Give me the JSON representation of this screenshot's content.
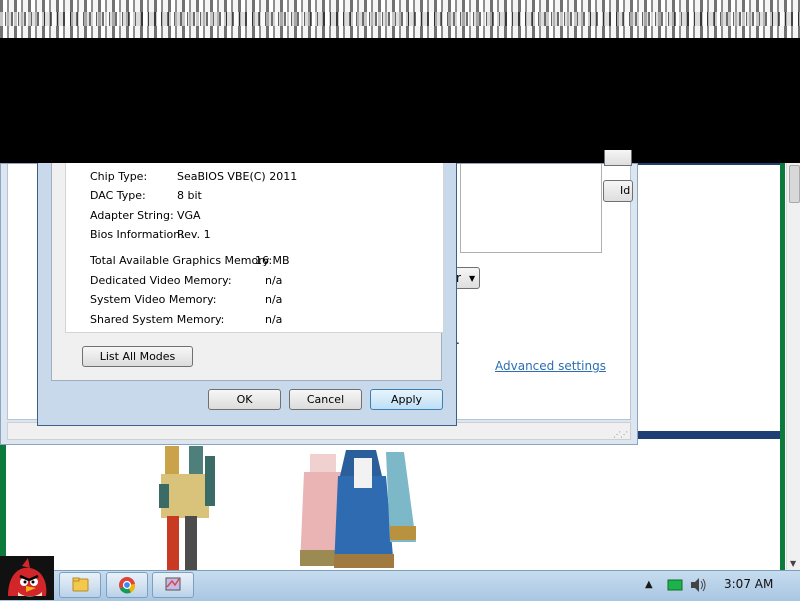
{
  "dialog": {
    "rows": [
      {
        "label": "Chip Type:",
        "value": "SeaBIOS VBE(C) 2011"
      },
      {
        "label": "DAC Type:",
        "value": "8 bit"
      },
      {
        "label": "Adapter String:",
        "value": "VGA"
      },
      {
        "label": "Bios Information:",
        "value": "Rev. 1"
      }
    ],
    "memory": [
      {
        "label": "Total Available Graphics Memory:",
        "value": "16 MB"
      },
      {
        "label": "Dedicated Video Memory:",
        "value": "n/a"
      },
      {
        "label": "System Video Memory:",
        "value": "n/a"
      },
      {
        "label": "Shared System Memory:",
        "value": "n/a"
      }
    ],
    "list_all_modes_label": "List All Modes",
    "ok_label": "OK",
    "cancel_label": "Cancel",
    "apply_label": "Apply"
  },
  "back_window": {
    "advanced_settings_link": "Advanced settings",
    "button_partial_text": "Id",
    "dropdown_partial_text": "r",
    "dot_text": "."
  },
  "taskbar": {
    "clock": "3:07 AM",
    "apps": [
      "angry-birds-icon",
      "folder-icon",
      "chrome-icon",
      "display-settings-icon"
    ]
  },
  "colors": {
    "accent_link": "#2a6fb5",
    "desktop_green": "#0b7a3a",
    "desktop_blue": "#1e3f73",
    "taskbar": "#b7d0e8"
  }
}
